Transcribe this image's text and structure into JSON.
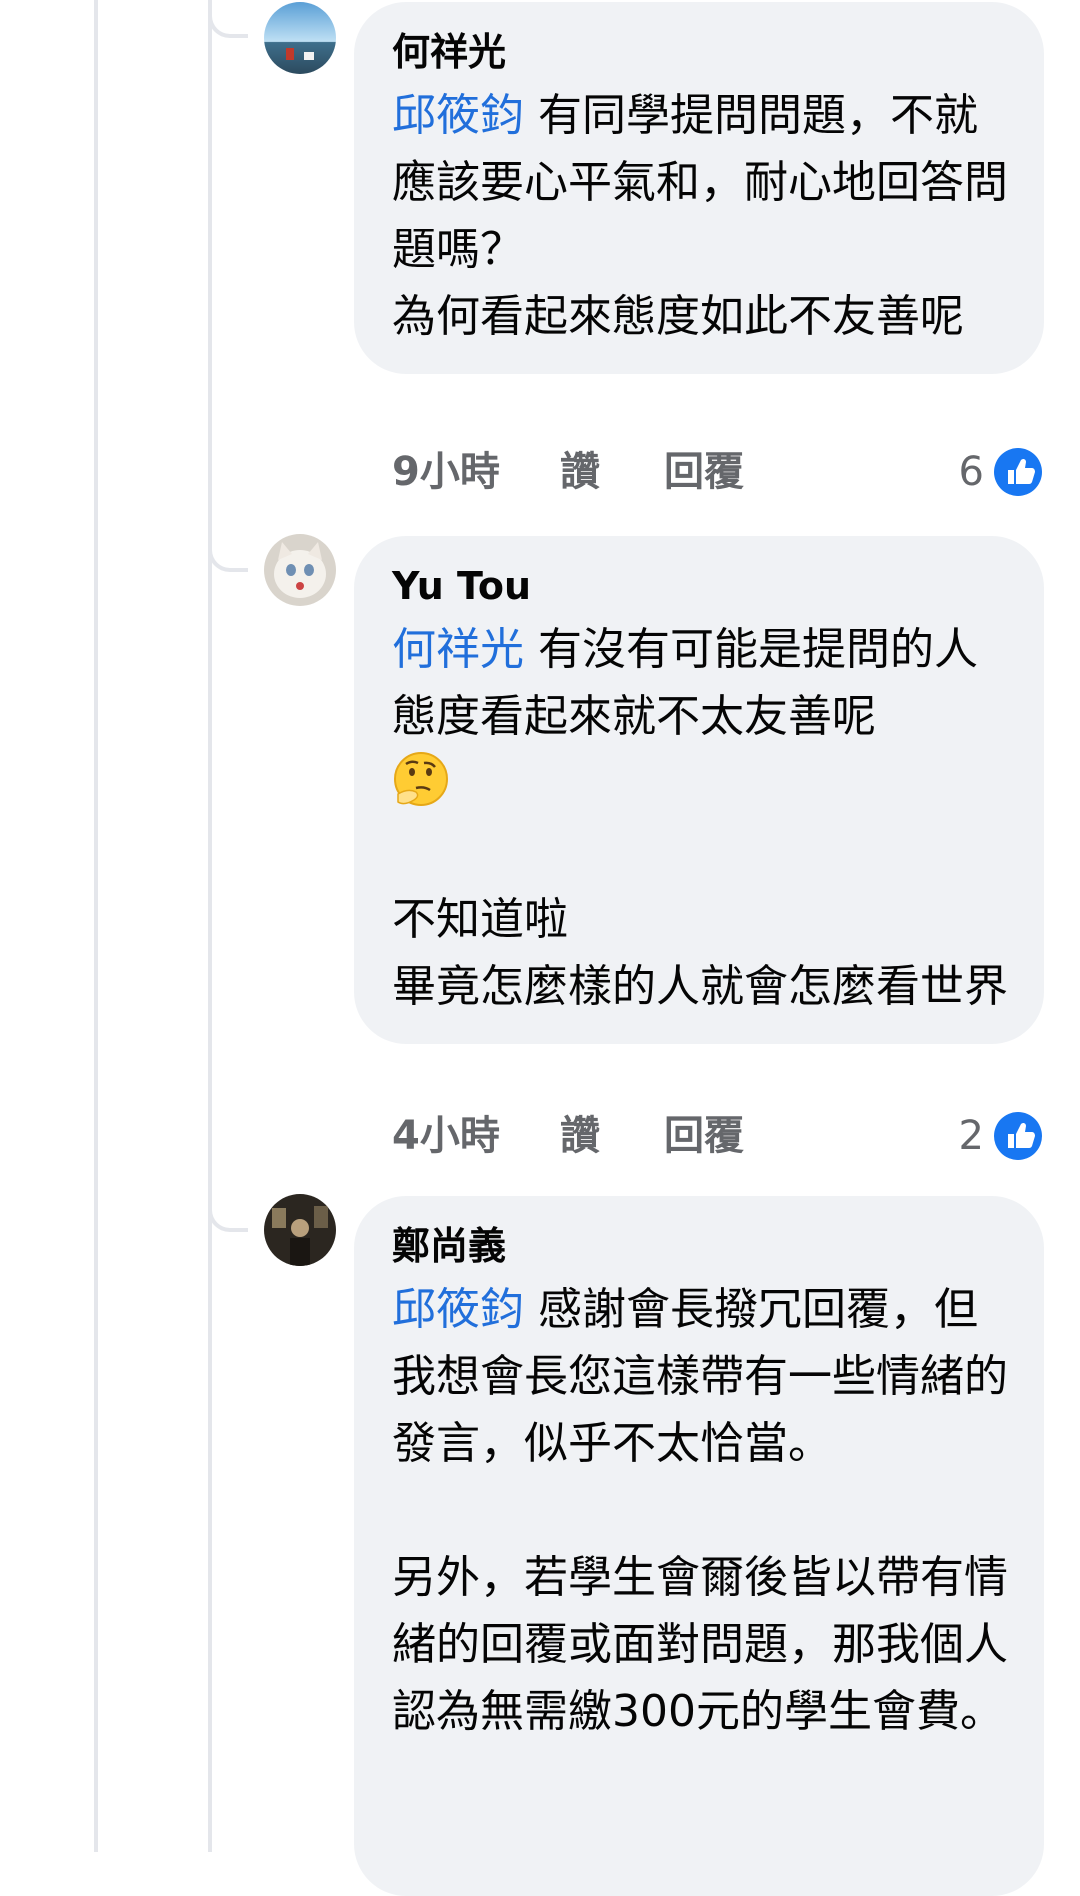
{
  "actions": {
    "like_label": "讚",
    "reply_label": "回覆"
  },
  "comments": [
    {
      "author": "何祥光",
      "mention": "邱筱鈞",
      "text": " 有同學提問問題，不就應該要心平氣和，耐心地回答問題嗎？\n為何看起來態度如此不友善呢",
      "time": "9小時",
      "reaction_count": "6",
      "avatar": "landscape-photo"
    },
    {
      "author": "Yu Tou",
      "mention": "何祥光",
      "text": " 有沒有可能是提問的人態度看起來就不太友善呢",
      "emoji": "thinking-face-emoji",
      "text_after": "\n\n不知道啦\n畢竟怎麼樣的人就會怎麼看世界",
      "time": "4小時",
      "reaction_count": "2",
      "avatar": "white-cat-photo"
    },
    {
      "author": "鄭尚義",
      "mention": "邱筱鈞",
      "text": " 感謝會長撥冗回覆，但我想會長您這樣帶有一些情緒的發言，似乎不太恰當。\n\n另外，若學生會爾後皆以帶有情緒的回覆或面對問題，那我個人認為無需繳300元的學生會費。",
      "avatar": "dark-room-photo"
    }
  ],
  "colors": {
    "mention": "#216fdb",
    "bubble": "#f0f2f5",
    "like_blue": "#1877f2",
    "meta_gray": "#65676b"
  }
}
